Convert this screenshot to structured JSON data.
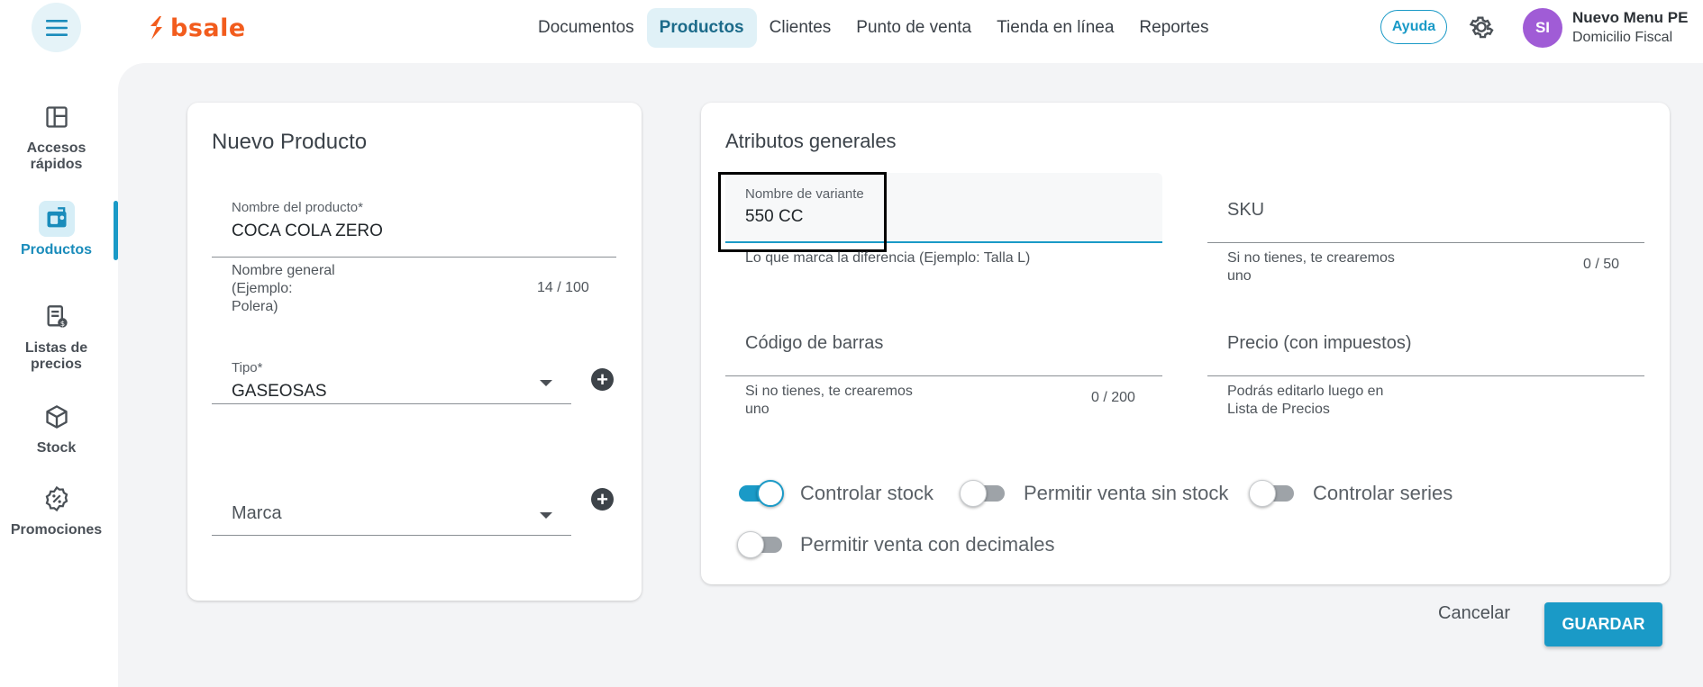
{
  "header": {
    "logo_text": "bsale",
    "nav": [
      {
        "label": "Documentos"
      },
      {
        "label": "Productos"
      },
      {
        "label": "Clientes"
      },
      {
        "label": "Punto de venta"
      },
      {
        "label": "Tienda en línea"
      },
      {
        "label": "Reportes"
      }
    ],
    "help_label": "Ayuda",
    "avatar_initials": "SI",
    "user_name": "Nuevo Menu PE",
    "user_subtitle": "Domicilio Fiscal"
  },
  "sidebar": {
    "items": [
      {
        "label_line1": "Accesos",
        "label_line2": "rápidos"
      },
      {
        "label_line1": "Productos",
        "label_line2": ""
      },
      {
        "label_line1": "Listas de",
        "label_line2": "precios"
      },
      {
        "label_line1": "Stock",
        "label_line2": ""
      },
      {
        "label_line1": "Promociones",
        "label_line2": ""
      }
    ]
  },
  "product_card": {
    "title": "Nuevo Producto",
    "name_label": "Nombre del producto*",
    "name_value": "COCA COLA ZERO",
    "name_helper_line1": "Nombre general",
    "name_helper_line2": "(Ejemplo:",
    "name_helper_line3": "Polera)",
    "name_counter": "14 / 100",
    "type_label": "Tipo*",
    "type_value": "GASEOSAS",
    "brand_placeholder": "Marca"
  },
  "attributes_card": {
    "title": "Atributos generales",
    "variant_label": "Nombre de variante",
    "variant_value": "550 CC",
    "variant_helper": "Lo que marca la diferencia (Ejemplo: Talla L)",
    "sku_placeholder": "SKU",
    "sku_helper_line1": "Si no tienes, te crearemos",
    "sku_helper_line2": "uno",
    "sku_counter": "0 / 50",
    "barcode_placeholder": "Código de barras",
    "barcode_helper_line1": "Si no tienes, te crearemos",
    "barcode_helper_line2": "uno",
    "barcode_counter": "0 / 200",
    "price_placeholder": "Precio (con impuestos)",
    "price_helper_line1": "Podrás editarlo luego en",
    "price_helper_line2": "Lista de Precios",
    "toggles": [
      {
        "label": "Controlar stock",
        "on": true
      },
      {
        "label": "Permitir venta sin stock",
        "on": false
      },
      {
        "label": "Controlar series",
        "on": false
      },
      {
        "label": "Permitir venta con decimales",
        "on": false
      }
    ]
  },
  "actions": {
    "cancel_label": "Cancelar",
    "save_label": "GUARDAR"
  },
  "colors": {
    "accent": "#1a9ac7",
    "brand": "#f25c1d",
    "avatar": "#a05cd6",
    "highlight": "#000000"
  },
  "icons": [
    "menu-icon",
    "bsale-logo-icon",
    "gear-icon",
    "layout-grid-icon",
    "products-icon",
    "price-list-icon",
    "cube-icon",
    "percent-badge-icon",
    "plus-icon",
    "caret-down-icon"
  ]
}
